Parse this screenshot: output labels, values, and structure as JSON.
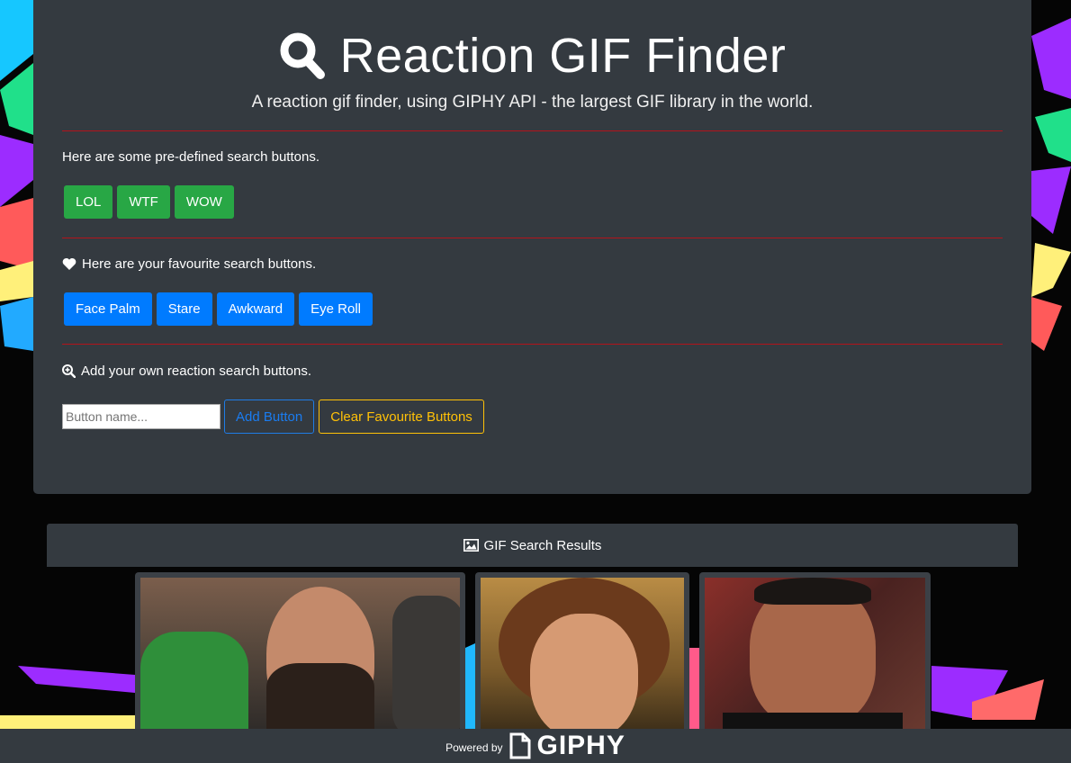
{
  "header": {
    "title": "Reaction GIF Finder",
    "subtitle": "A reaction gif finder, using GIPHY API - the largest GIF library in the world."
  },
  "predefined": {
    "label": "Here are some pre-defined search buttons.",
    "buttons": [
      "LOL",
      "WTF",
      "WOW"
    ]
  },
  "favourites": {
    "label": "Here are your favourite search buttons.",
    "buttons": [
      "Face Palm",
      "Stare",
      "Awkward",
      "Eye Roll"
    ]
  },
  "add_section": {
    "label": "Add your own reaction search buttons.",
    "input_placeholder": "Button name...",
    "add_button": "Add Button",
    "clear_button": "Clear Favourite Buttons"
  },
  "results": {
    "header": "GIF Search Results"
  },
  "footer": {
    "powered_by": "Powered by",
    "brand": "GIPHY"
  },
  "colors": {
    "panel": "#343a40",
    "green": "#28a745",
    "blue": "#007bff",
    "yellow": "#ffc107",
    "divider": "#b3131b"
  }
}
